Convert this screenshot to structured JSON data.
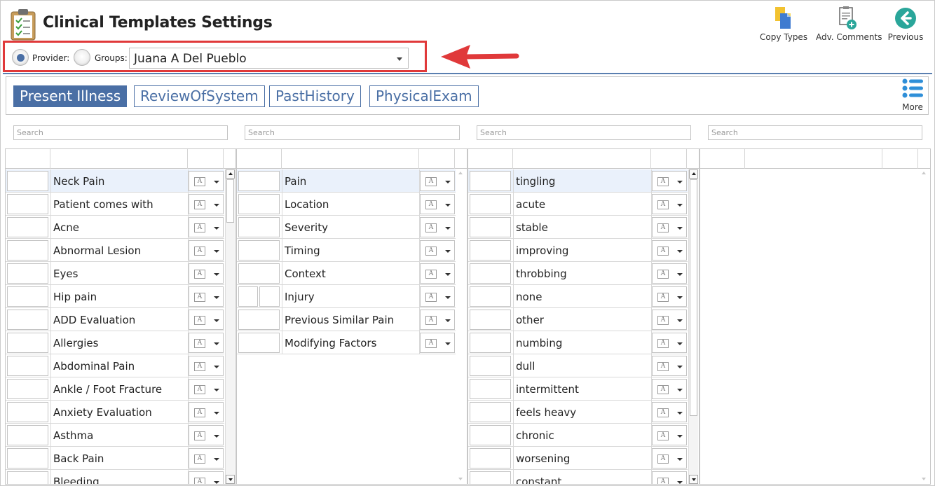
{
  "header": {
    "title": "Clinical Templates Settings"
  },
  "toolbar": {
    "copy_types": "Copy Types",
    "adv_comments": "Adv. Comments",
    "previous": "Previous"
  },
  "selector": {
    "provider_label": "Provider:",
    "groups_label": "Groups:",
    "selected_value": "Juana A Del Pueblo"
  },
  "tabs": [
    {
      "label": "Present Illness",
      "active": true
    },
    {
      "label": "ReviewOfSystem",
      "active": false
    },
    {
      "label": "PastHistory",
      "active": false
    },
    {
      "label": "PhysicalExam",
      "active": false
    }
  ],
  "more_label": "More",
  "search_placeholder": "Search",
  "columns": [
    {
      "items": [
        "Neck Pain",
        "Patient comes with",
        "Acne",
        "Abnormal Lesion",
        "Eyes",
        "Hip pain",
        "ADD Evaluation",
        "Allergies",
        "Abdominal Pain",
        "Ankle / Foot Fracture",
        "Anxiety Evaluation",
        "Asthma",
        "Back Pain",
        "Bleeding"
      ],
      "selected_index": 0
    },
    {
      "items": [
        "Pain",
        "Location",
        "Severity",
        "Timing",
        "Context",
        "Injury",
        "Previous Similar Pain",
        "Modifying Factors"
      ],
      "selected_index": 0
    },
    {
      "items": [
        "tingling",
        "acute",
        "stable",
        "improving",
        "throbbing",
        "none",
        "other",
        "numbing",
        "dull",
        "intermittent",
        "feels heavy",
        "chronic",
        "worsening",
        "constant"
      ],
      "selected_index": 0
    },
    {
      "items": [],
      "selected_index": -1
    }
  ],
  "colors": {
    "accent": "#4a6fa5",
    "highlight_border": "#e0393a",
    "selected_row": "#eaf1fb"
  },
  "icons": {
    "app": "clipboard-icon",
    "copy": "copy-types-icon",
    "comments": "adv-comments-icon",
    "previous": "arrow-left-circle-icon",
    "more": "list-icon",
    "font": "font-aa-icon"
  }
}
